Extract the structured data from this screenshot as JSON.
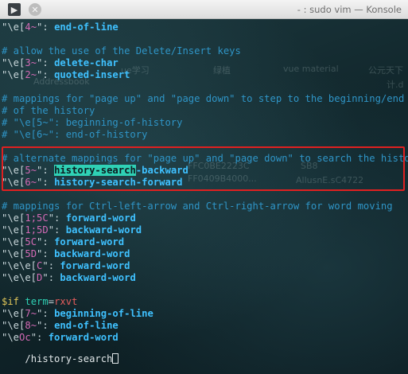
{
  "window": {
    "title": "- : sudo vim — Konsole",
    "menu_icon_glyph": "▶",
    "close_glyph": "✕"
  },
  "background_text": [
    "Addressbook",
    "ue学习",
    "绿植",
    "vue material",
    "公元天下",
    "计.d",
    "FFC0BE2223C",
    "SB8",
    "FF0409B4000...",
    "AllusnE.sC4722"
  ],
  "lines": [
    {
      "segments": [
        {
          "cls": "c-str",
          "t": "\"\\e["
        },
        {
          "cls": "c-esc",
          "t": "4~"
        },
        {
          "cls": "c-str",
          "t": "\": "
        },
        {
          "cls": "c-key",
          "t": "end-of-line"
        }
      ]
    },
    {
      "segments": []
    },
    {
      "segments": [
        {
          "cls": "c-com",
          "t": "# allow the use of the Delete/Insert keys"
        }
      ]
    },
    {
      "segments": [
        {
          "cls": "c-str",
          "t": "\"\\e["
        },
        {
          "cls": "c-esc",
          "t": "3~"
        },
        {
          "cls": "c-str",
          "t": "\": "
        },
        {
          "cls": "c-key",
          "t": "delete-char"
        }
      ]
    },
    {
      "segments": [
        {
          "cls": "c-str",
          "t": "\"\\e["
        },
        {
          "cls": "c-esc",
          "t": "2~"
        },
        {
          "cls": "c-str",
          "t": "\": "
        },
        {
          "cls": "c-key",
          "t": "quoted-insert"
        }
      ]
    },
    {
      "segments": []
    },
    {
      "segments": [
        {
          "cls": "c-com",
          "t": "# mappings for \"page up\" and \"page down\" to step to the beginning/end"
        }
      ]
    },
    {
      "segments": [
        {
          "cls": "c-com",
          "t": "# of the history"
        }
      ]
    },
    {
      "segments": [
        {
          "cls": "c-com",
          "t": "# \"\\e[5~\": beginning-of-history"
        }
      ]
    },
    {
      "segments": [
        {
          "cls": "c-com",
          "t": "# \"\\e[6~\": end-of-history"
        }
      ]
    },
    {
      "segments": []
    },
    {
      "segments": [
        {
          "cls": "c-com",
          "t": "# alternate mappings for \"page up\" and \"page down\" to search the history"
        }
      ]
    },
    {
      "segments": [
        {
          "cls": "c-str",
          "t": "\"\\e["
        },
        {
          "cls": "c-esc",
          "t": "5~"
        },
        {
          "cls": "c-str",
          "t": "\": "
        },
        {
          "cls": "c-hl",
          "t": "history-search"
        },
        {
          "cls": "c-key",
          "t": "-backward"
        }
      ]
    },
    {
      "segments": [
        {
          "cls": "c-str",
          "t": "\"\\e["
        },
        {
          "cls": "c-esc",
          "t": "6~"
        },
        {
          "cls": "c-str",
          "t": "\": "
        },
        {
          "cls": "c-key",
          "t": "history-search-forward"
        }
      ]
    },
    {
      "segments": []
    },
    {
      "segments": [
        {
          "cls": "c-com",
          "t": "# mappings for Ctrl-left-arrow and Ctrl-right-arrow for word moving"
        }
      ]
    },
    {
      "segments": [
        {
          "cls": "c-str",
          "t": "\"\\e["
        },
        {
          "cls": "c-esc",
          "t": "1;5C"
        },
        {
          "cls": "c-str",
          "t": "\": "
        },
        {
          "cls": "c-key",
          "t": "forward-word"
        }
      ]
    },
    {
      "segments": [
        {
          "cls": "c-str",
          "t": "\"\\e["
        },
        {
          "cls": "c-esc",
          "t": "1;5D"
        },
        {
          "cls": "c-str",
          "t": "\": "
        },
        {
          "cls": "c-key",
          "t": "backward-word"
        }
      ]
    },
    {
      "segments": [
        {
          "cls": "c-str",
          "t": "\"\\e["
        },
        {
          "cls": "c-esc",
          "t": "5C"
        },
        {
          "cls": "c-str",
          "t": "\": "
        },
        {
          "cls": "c-key",
          "t": "forward-word"
        }
      ]
    },
    {
      "segments": [
        {
          "cls": "c-str",
          "t": "\"\\e["
        },
        {
          "cls": "c-esc",
          "t": "5D"
        },
        {
          "cls": "c-str",
          "t": "\": "
        },
        {
          "cls": "c-key",
          "t": "backward-word"
        }
      ]
    },
    {
      "segments": [
        {
          "cls": "c-str",
          "t": "\"\\e\\e["
        },
        {
          "cls": "c-esc",
          "t": "C"
        },
        {
          "cls": "c-str",
          "t": "\": "
        },
        {
          "cls": "c-key",
          "t": "forward-word"
        }
      ]
    },
    {
      "segments": [
        {
          "cls": "c-str",
          "t": "\"\\e\\e["
        },
        {
          "cls": "c-esc",
          "t": "D"
        },
        {
          "cls": "c-str",
          "t": "\": "
        },
        {
          "cls": "c-key",
          "t": "backward-word"
        }
      ]
    },
    {
      "segments": []
    },
    {
      "segments": [
        {
          "cls": "c-kw",
          "t": "$if"
        },
        {
          "cls": "c-str",
          "t": " "
        },
        {
          "cls": "c-var",
          "t": "term"
        },
        {
          "cls": "c-str",
          "t": "="
        },
        {
          "cls": "c-red",
          "t": "rxvt"
        }
      ]
    },
    {
      "segments": [
        {
          "cls": "c-str",
          "t": "\"\\e["
        },
        {
          "cls": "c-esc",
          "t": "7~"
        },
        {
          "cls": "c-str",
          "t": "\": "
        },
        {
          "cls": "c-key",
          "t": "beginning-of-line"
        }
      ]
    },
    {
      "segments": [
        {
          "cls": "c-str",
          "t": "\"\\e["
        },
        {
          "cls": "c-esc",
          "t": "8~"
        },
        {
          "cls": "c-str",
          "t": "\": "
        },
        {
          "cls": "c-key",
          "t": "end-of-line"
        }
      ]
    },
    {
      "segments": [
        {
          "cls": "c-str",
          "t": "\"\\e"
        },
        {
          "cls": "c-esc",
          "t": "Oc"
        },
        {
          "cls": "c-str",
          "t": "\": "
        },
        {
          "cls": "c-key",
          "t": "forward-word"
        }
      ]
    }
  ],
  "command_line": "/history-search"
}
